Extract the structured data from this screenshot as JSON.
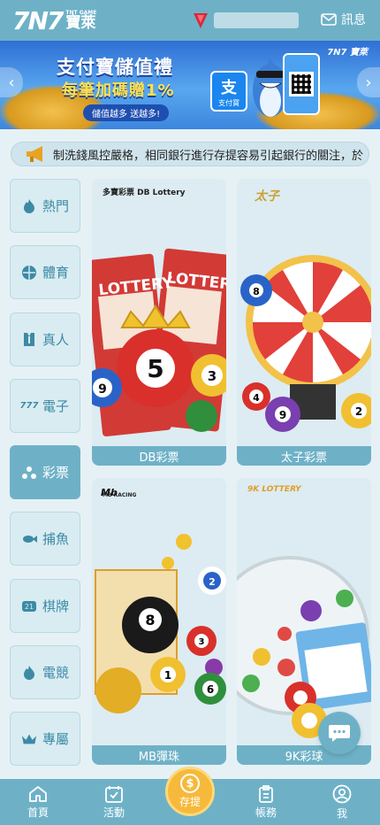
{
  "header": {
    "logo_mark": "7N7",
    "logo_small": "TNT GAME",
    "logo_cn": "寶萊",
    "messages_label": "訊息"
  },
  "banner": {
    "title": "支付寶儲值禮",
    "subtitle": "每筆加碼贈1%",
    "pill": "儲值越多 送越多!",
    "alipay_label": "支付寶",
    "alipay_char": "支",
    "brand": "7N7 寶萊"
  },
  "marquee": {
    "text": "制洗錢風控嚴格，相同銀行進行存提容易引起銀行的關注，於"
  },
  "sidenav": {
    "items": [
      {
        "label": "熱門",
        "icon": "fire-icon"
      },
      {
        "label": "體育",
        "icon": "ball-icon"
      },
      {
        "label": "真人",
        "icon": "suit-icon"
      },
      {
        "label": "電子",
        "icon": "slot-777-icon"
      },
      {
        "label": "彩票",
        "icon": "lottery-balls-icon"
      },
      {
        "label": "捕魚",
        "icon": "fish-icon"
      },
      {
        "label": "棋牌",
        "icon": "mahjong-icon"
      },
      {
        "label": "電競",
        "icon": "fire-icon"
      },
      {
        "label": "專屬",
        "icon": "crown-icon"
      }
    ],
    "active_index": 4
  },
  "games": [
    {
      "label": "DB彩票",
      "brand": "多寶彩票 DB Lottery"
    },
    {
      "label": "太子彩票",
      "brand": ""
    },
    {
      "label": "MB彈珠",
      "brand": "MB RACING"
    },
    {
      "label": "9K彩球",
      "brand": "9K LOTTERY"
    }
  ],
  "bottomnav": {
    "items": [
      {
        "label": "首頁",
        "icon": "home-icon"
      },
      {
        "label": "活動",
        "icon": "calendar-check-icon"
      },
      {
        "label": "存提",
        "icon": "coin-icon"
      },
      {
        "label": "帳務",
        "icon": "clipboard-icon"
      },
      {
        "label": "我",
        "icon": "user-icon"
      }
    ]
  },
  "colors": {
    "primary": "#6eb1c7",
    "background": "#e6f1f5",
    "deposit": "#f6b93b"
  }
}
